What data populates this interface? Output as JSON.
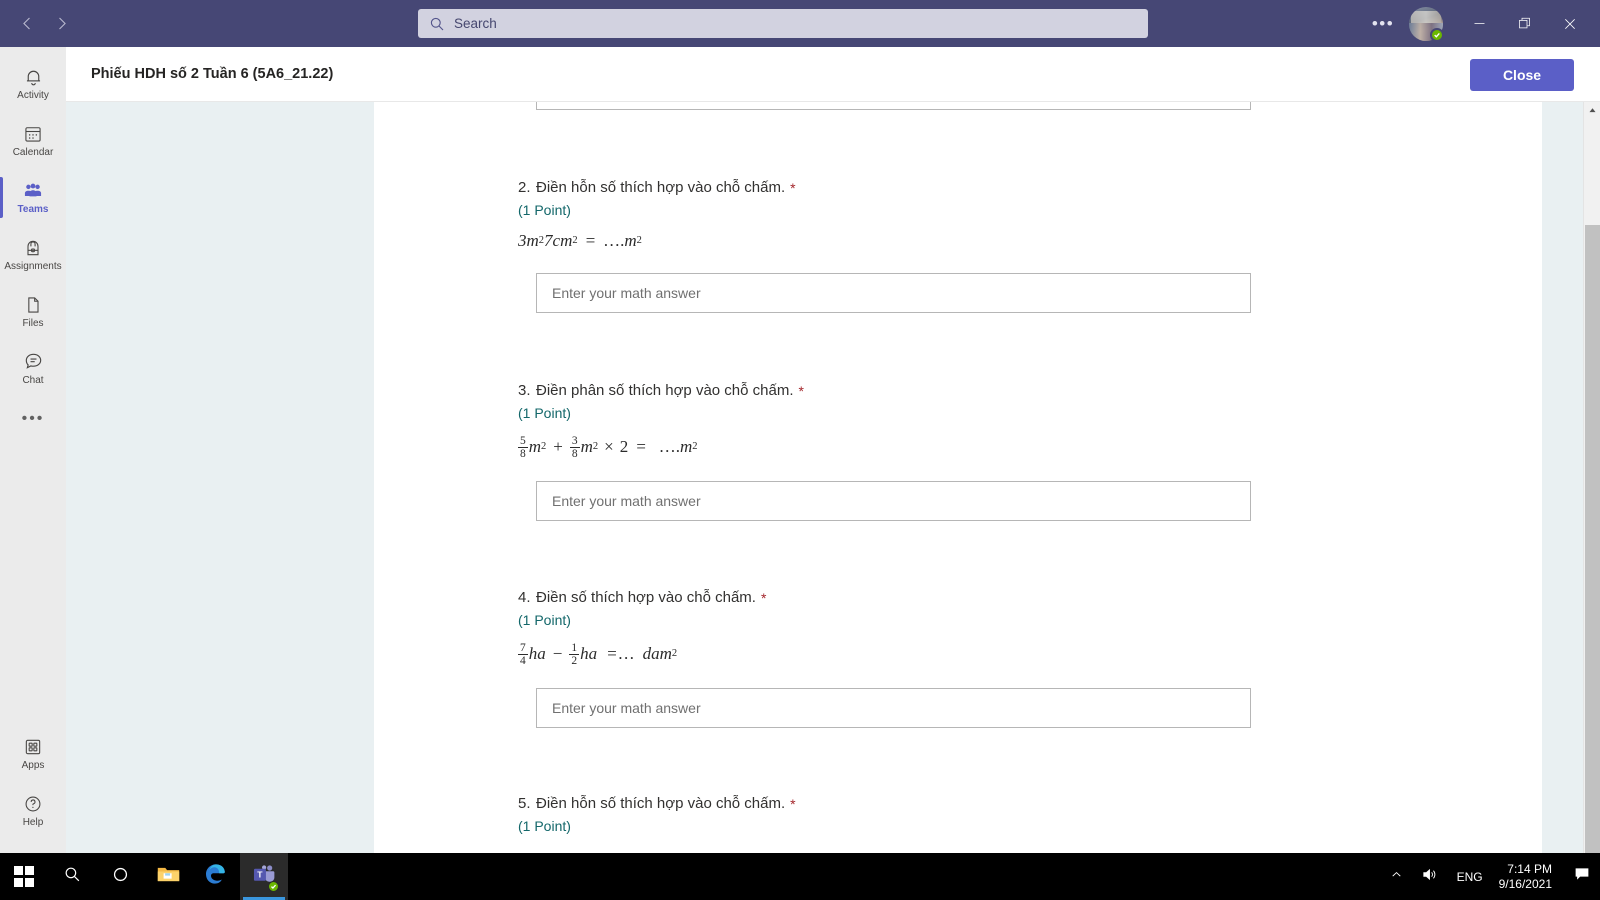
{
  "titlebar": {
    "back_icon": "chevron-left-icon",
    "forward_icon": "chevron-right-icon",
    "search": {
      "placeholder": "Search",
      "icon": "search-icon"
    },
    "more_label": "•••",
    "presence_status": "available",
    "minimize_label": "Minimize",
    "restore_label": "Restore",
    "close_label": "Close",
    "bg_color": "#464775"
  },
  "rail": {
    "items": [
      {
        "label": "Activity",
        "icon": "bell-icon",
        "active": false
      },
      {
        "label": "Calendar",
        "icon": "calendar-icon",
        "active": false
      },
      {
        "label": "Teams",
        "icon": "teams-people-icon",
        "active": true
      },
      {
        "label": "Assignments",
        "icon": "backpack-icon",
        "active": false
      },
      {
        "label": "Files",
        "icon": "file-icon",
        "active": false
      },
      {
        "label": "Chat",
        "icon": "chat-bubble-icon",
        "active": false
      }
    ],
    "more_label": "•••",
    "bottom_items": [
      {
        "label": "Apps",
        "icon": "apps-grid-icon"
      },
      {
        "label": "Help",
        "icon": "question-circle-icon"
      }
    ],
    "accent_color": "#5b5fc7"
  },
  "assignment": {
    "title": "Phiếu HDH số 2 Tuần 6 (5A6_21.22)",
    "close_label": "Close",
    "close_color": "#5b5fc7"
  },
  "form": {
    "answer_placeholder": "Enter your math answer",
    "points_color": "#13676a",
    "required_marker": "*",
    "questions": [
      {
        "number": "2.",
        "prompt": "Điền hỗn số thích hợp vào chỗ chấm.",
        "points": "(1 Point)",
        "math": "3m²7cm² = ….m²",
        "answer_value": ""
      },
      {
        "number": "3.",
        "prompt": "Điền phân số thích hợp vào chỗ chấm.",
        "points": "(1 Point)",
        "math": "5/8 m² + 3/8 m² × 2 = ….m²",
        "answer_value": ""
      },
      {
        "number": "4.",
        "prompt": "Điền số thích hợp vào chỗ chấm.",
        "points": "(1 Point)",
        "math": "7/4 ha − 1/2 ha =… dam²",
        "answer_value": ""
      },
      {
        "number": "5.",
        "prompt": "Điền hỗn số thích hợp vào chỗ chấm.",
        "points": "(1 Point)",
        "math": "",
        "answer_value": ""
      }
    ],
    "math_parts": {
      "q2": {
        "a": "3",
        "a_unit": "m",
        "a_exp": "2",
        "b": "7",
        "b_unit": "cm",
        "b_exp": "2",
        "eq": "=",
        "blank": "….",
        "res_unit": "m",
        "res_exp": "2"
      },
      "q3": {
        "f1n": "5",
        "f1d": "8",
        "u1": "m",
        "e1": "2",
        "op1": "+",
        "f2n": "3",
        "f2d": "8",
        "u2": "m",
        "e2": "2",
        "op2": "×",
        "mult": "2",
        "eq": "=",
        "blank": "….",
        "ru": "m",
        "re": "2"
      },
      "q4": {
        "f1n": "7",
        "f1d": "4",
        "u1": "ha",
        "op1": "−",
        "f2n": "1",
        "f2d": "2",
        "u2": "ha",
        "eq": "=",
        "blank": "…",
        "ru": "dam",
        "re": "2"
      }
    }
  },
  "taskbar": {
    "items": [
      {
        "name": "start",
        "icon": "windows-logo-icon"
      },
      {
        "name": "search",
        "icon": "search-icon"
      },
      {
        "name": "cortana",
        "icon": "circle-icon"
      },
      {
        "name": "file-explorer",
        "icon": "folder-icon"
      },
      {
        "name": "edge",
        "icon": "edge-icon"
      },
      {
        "name": "teams",
        "icon": "teams-icon"
      }
    ],
    "tray": {
      "chevron": "chevron-up-icon",
      "volume": "speaker-icon",
      "language": "ENG",
      "time": "7:14 PM",
      "date": "9/16/2021",
      "action_center": "notification-icon"
    }
  },
  "colors": {
    "teams_purple": "#464775",
    "accent": "#5b5fc7",
    "page_bg": "#e9f0f2",
    "required": "#a4262c"
  }
}
